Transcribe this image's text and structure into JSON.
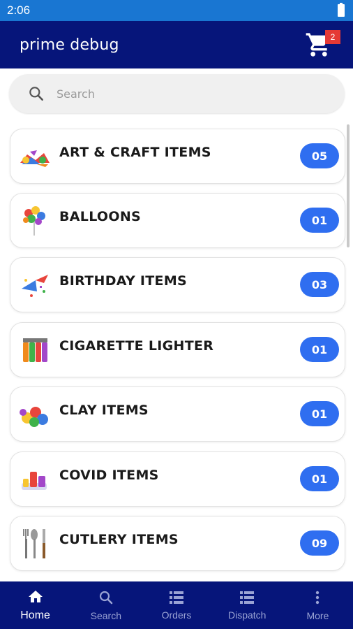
{
  "status_bar": {
    "time": "2:06"
  },
  "app_bar": {
    "title": "prime debug",
    "cart_count": "2"
  },
  "search": {
    "placeholder": "Search"
  },
  "categories": [
    {
      "label": "ART & CRAFT ITEMS",
      "count": "05",
      "icon": "art-craft-icon"
    },
    {
      "label": "BALLOONS",
      "count": "01",
      "icon": "balloons-icon"
    },
    {
      "label": "BIRTHDAY ITEMS",
      "count": "03",
      "icon": "birthday-icon"
    },
    {
      "label": "CIGARETTE LIGHTER",
      "count": "01",
      "icon": "lighter-icon"
    },
    {
      "label": "CLAY ITEMS",
      "count": "01",
      "icon": "clay-icon"
    },
    {
      "label": "COVID ITEMS",
      "count": "01",
      "icon": "covid-icon"
    },
    {
      "label": "CUTLERY ITEMS",
      "count": "09",
      "icon": "cutlery-icon"
    }
  ],
  "bottom_nav": [
    {
      "label": "Home",
      "icon": "home-icon",
      "active": true
    },
    {
      "label": "Search",
      "icon": "search-icon",
      "active": false
    },
    {
      "label": "Orders",
      "icon": "list-icon",
      "active": false
    },
    {
      "label": "Dispatch",
      "icon": "list-icon",
      "active": false
    },
    {
      "label": "More",
      "icon": "more-vert-icon",
      "active": false
    }
  ],
  "colors": {
    "status_bar": "#1976d2",
    "app_bar": "#06157a",
    "badge": "#2f6ef0",
    "cart_badge": "#e53935"
  }
}
